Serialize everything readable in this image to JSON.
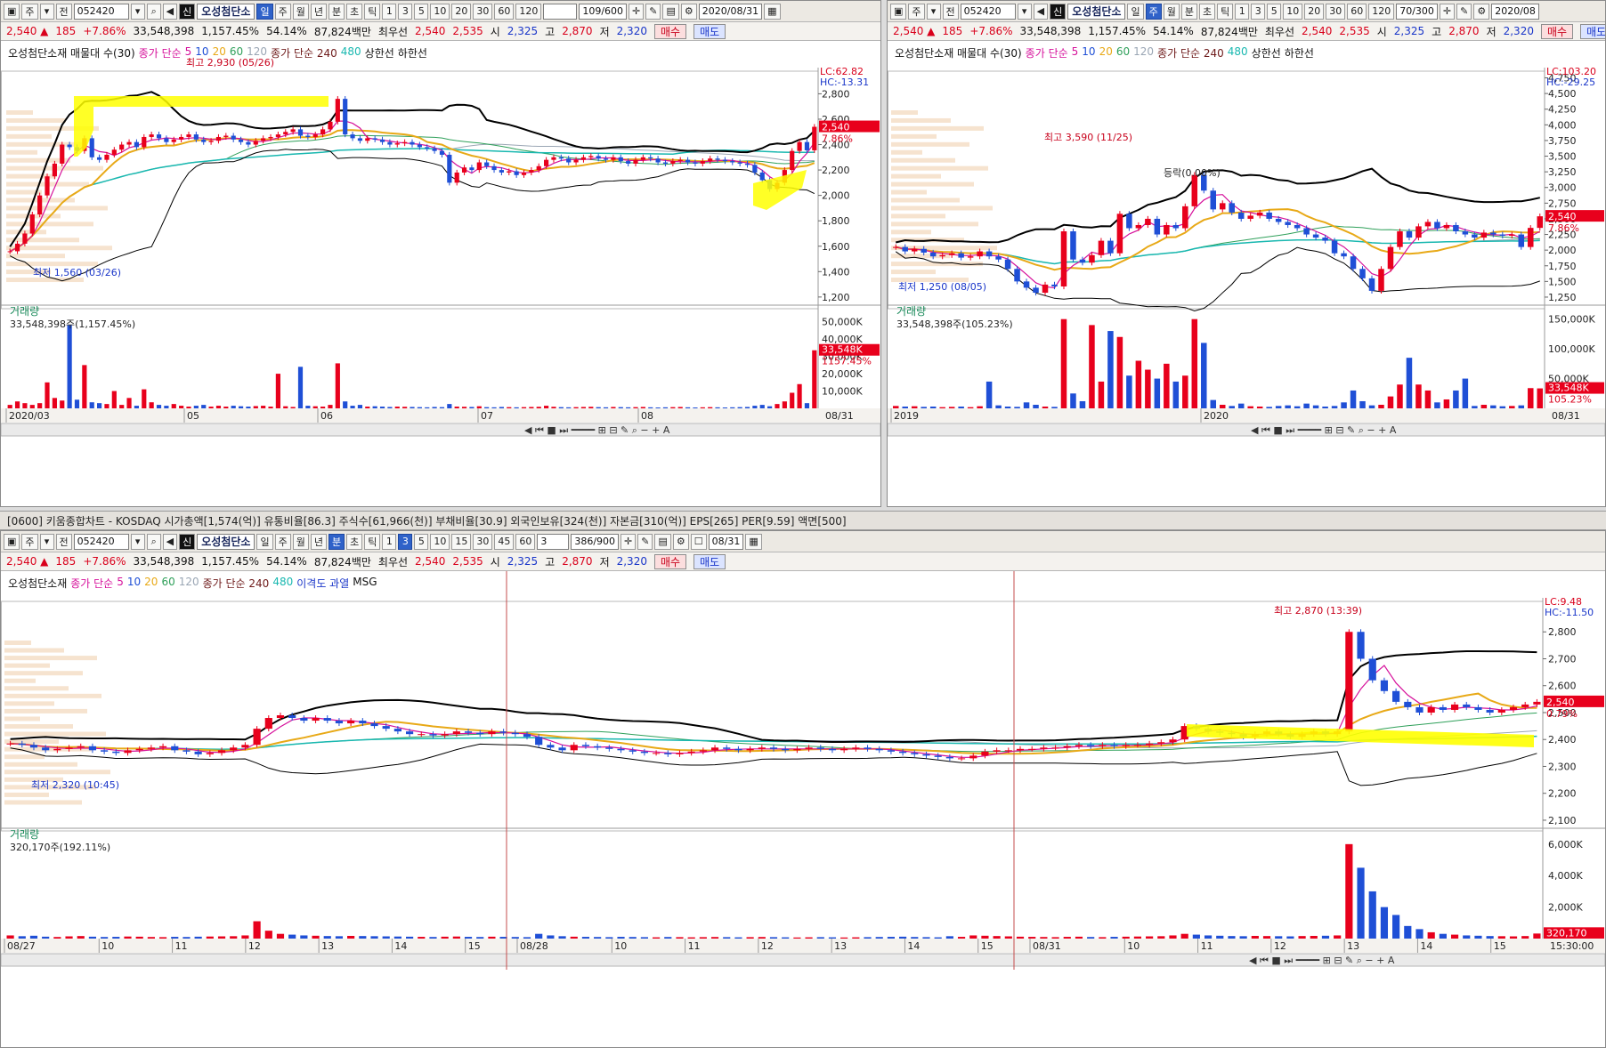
{
  "colors": {
    "up": "#e8001c",
    "down": "#1f4fd6",
    "ma5": "#d6119b",
    "ma20": "#e8a917",
    "ma60": "#2fa05a",
    "ma120": "#9aa6b4",
    "ma240": "#19b8b0",
    "ma480": "#6e1a1a",
    "boll": "#000000",
    "highlight": "#ffff00"
  },
  "panels": [
    {
      "id": "p1",
      "toolbar": {
        "type": "주",
        "prev": "전",
        "code": "052420",
        "badge": "신",
        "name": "오성첨단소",
        "periods": [
          "일",
          "주",
          "월",
          "년",
          "분",
          "초",
          "틱"
        ],
        "selected": "일",
        "nums": [
          "1",
          "3",
          "5",
          "10",
          "20",
          "30",
          "60",
          "120"
        ],
        "count": "109/600",
        "date": "2020/08/31"
      },
      "quote": {
        "price": "2,540 ▲",
        "change": "185",
        "rate": "+7.86%",
        "volume": "33,548,398",
        "vrate": "1,157.45%",
        "ratio": "54.14%",
        "amount": "87,824백만",
        "label": "최우선",
        "ask": "2,540",
        "bid": "2,535",
        "open_l": "시",
        "open": "2,325",
        "high_l": "고",
        "high": "2,870",
        "low_l": "저",
        "low": "2,320",
        "buy": "매수",
        "sell": "매도"
      },
      "legend": {
        "name": "오성첨단소재 매물대 수(30)",
        "ma_label": "종가 단순",
        "ma5": "5",
        "ma10": "10",
        "ma20": "20",
        "ma60": "60",
        "ma120": "120",
        "ma2_label": "종가 단순 240",
        "ma480": "480",
        "limit_up": "상한선",
        "limit_down": "하한선"
      },
      "lc": "LC:62.82",
      "hc": "HC:-13.31",
      "price_tag": "2,540",
      "pct_tag": "7.86%",
      "vol_label": "거래량",
      "vol_value": "33,548,398주(1,157.45%)",
      "vol_tag": "33,548K",
      "vol_pct_tag": "1157.45%",
      "date_start": "2020/03",
      "date_end": "08/31",
      "annotations": [
        {
          "text": "최고 2,930 (05/26)"
        },
        {
          "text": "최저 1,560 (03/26)"
        }
      ]
    },
    {
      "id": "p2",
      "toolbar": {
        "type": "주",
        "prev": "전",
        "code": "052420",
        "badge": "신",
        "name": "오성첨단소",
        "periods": [
          "일",
          "주",
          "월",
          "년",
          "분",
          "초",
          "틱"
        ],
        "selected": "주",
        "nums": [
          "1",
          "3",
          "5",
          "10",
          "20",
          "30",
          "60",
          "120"
        ],
        "count": "70/300",
        "date": "2020/08"
      },
      "quote": {
        "price": "2,540 ▲",
        "change": "185",
        "rate": "+7.86%",
        "volume": "33,548,398",
        "vrate": "1,157.45%",
        "ratio": "54.14%",
        "amount": "87,824백만",
        "label": "최우선",
        "ask": "2,540",
        "bid": "2,535",
        "open_l": "시",
        "open": "2,325",
        "high_l": "고",
        "high": "2,870",
        "low_l": "저",
        "low": "2,320",
        "buy": "매수",
        "sell": "매도"
      },
      "legend": {
        "name": "오성첨단소재 매물대 수(30)",
        "ma_label": "종가 단순",
        "ma5": "5",
        "ma10": "10",
        "ma20": "20",
        "ma60": "60",
        "ma120": "120",
        "ma2_label": "종가 단순 240",
        "ma480": "480",
        "limit_up": "상한선",
        "limit_down": "하한선"
      },
      "lc": "LC:103.20",
      "hc": "HC:-29.25",
      "price_tag": "2,540",
      "pct_tag": "7.86%",
      "vol_label": "거래량",
      "vol_value": "33,548,398주(105.23%)",
      "vol_tag": "33,548K",
      "vol_pct_tag": "105.23%",
      "date_start": "2019",
      "date_end": "08/31",
      "annotations": [
        {
          "text": "최고 3,590 (11/25)"
        },
        {
          "text": "최저 1,250 (08/05)"
        },
        {
          "text": "등락(0.00%)"
        }
      ]
    },
    {
      "id": "p3",
      "title": "[0600] 키움종합차트 - KOSDAQ 시가총액[1,574(억)] 유통비율[86.3] 주식수[61,966(천)] 부채비율[30.9] 외국인보유[324(천)] 자본금[310(억)] EPS[265] PER[9.59] 액면[500]",
      "toolbar": {
        "type": "주",
        "prev": "전",
        "code": "052420",
        "badge": "신",
        "name": "오성첨단소",
        "periods": [
          "일",
          "주",
          "월",
          "년",
          "분",
          "초",
          "틱"
        ],
        "selected": "분",
        "nums": [
          "1",
          "3",
          "5",
          "10",
          "15",
          "30",
          "45",
          "60"
        ],
        "sel_num": "3",
        "interval": "3",
        "count": "386/900",
        "date": "08/31"
      },
      "quote": {
        "price": "2,540 ▲",
        "change": "185",
        "rate": "+7.86%",
        "volume": "33,548,398",
        "vrate": "1,157.45%",
        "ratio": "54.14%",
        "amount": "87,824백만",
        "label": "최우선",
        "ask": "2,540",
        "bid": "2,535",
        "open_l": "시",
        "open": "2,325",
        "high_l": "고",
        "high": "2,870",
        "low_l": "저",
        "low": "2,320",
        "buy": "매수",
        "sell": "매도"
      },
      "legend": {
        "name": "오성첨단소재",
        "ma_label": "종가 단순",
        "ma5": "5",
        "ma10": "10",
        "ma20": "20",
        "ma60": "60",
        "ma120": "120",
        "ma2_label": "종가 단순 240",
        "ma480": "480",
        "extra1": "이격도 과열",
        "extra2": "MSG"
      },
      "lc": "LC:9.48",
      "hc": "HC:-11.50",
      "price_tag": "2,540",
      "pct_tag": "0.79%",
      "vol_label": "거래량",
      "vol_value": "320,170주(192.11%)",
      "vol_tag": "320,170",
      "vol_pct_tag": "192.11%",
      "date_end": "15:30:00",
      "annotations": [
        {
          "text": "최고 2,870 (13:39)"
        },
        {
          "text": "최저 2,320 (10:45)"
        }
      ]
    }
  ],
  "chart_data": [
    {
      "type": "candlestick",
      "panel": "p1",
      "x_labels": [
        "2020/03",
        "05",
        "06",
        "07",
        "08"
      ],
      "y_ticks": [
        "2,800",
        "2,600",
        "2,400",
        "2,200",
        "2,000",
        "1,800",
        "1,600",
        "1,400",
        "1,200"
      ],
      "ylim": [
        1150,
        2950
      ],
      "volume_ticks": [
        "50,000K",
        "40,000K",
        "30,000K",
        "20,000K",
        "10,000K"
      ],
      "volume_ylim": [
        0,
        55000
      ],
      "close": [
        1560,
        1620,
        1700,
        1850,
        2000,
        2150,
        2250,
        2400,
        2380,
        2350,
        2450,
        2300,
        2280,
        2320,
        2360,
        2400,
        2420,
        2380,
        2460,
        2480,
        2450,
        2420,
        2440,
        2460,
        2480,
        2440,
        2420,
        2430,
        2460,
        2470,
        2440,
        2420,
        2400,
        2430,
        2450,
        2460,
        2480,
        2500,
        2520,
        2470,
        2460,
        2480,
        2520,
        2580,
        2760,
        2480,
        2450,
        2430,
        2450,
        2440,
        2420,
        2400,
        2410,
        2420,
        2400,
        2380,
        2370,
        2350,
        2320,
        2100,
        2180,
        2220,
        2200,
        2260,
        2230,
        2200,
        2180,
        2190,
        2160,
        2180,
        2200,
        2230,
        2280,
        2300,
        2290,
        2260,
        2280,
        2300,
        2310,
        2290,
        2280,
        2300,
        2270,
        2250,
        2280,
        2300,
        2290,
        2260,
        2250,
        2270,
        2280,
        2260,
        2250,
        2270,
        2290,
        2280,
        2270,
        2260,
        2250,
        2240,
        2180,
        2120,
        2050,
        2100,
        2200,
        2350,
        2420,
        2355,
        2540
      ],
      "volume": [
        2000,
        4000,
        3000,
        2000,
        3000,
        15000,
        6000,
        4500,
        48000,
        5000,
        25000,
        3500,
        3000,
        2500,
        10000,
        2000,
        6000,
        1500,
        11000,
        3500,
        2000,
        1500,
        2500,
        1500,
        1000,
        1500,
        2000,
        1000,
        1500,
        1000,
        1500,
        1200,
        1000,
        1300,
        1500,
        1000,
        20000,
        1200,
        800,
        24000,
        1500,
        1200,
        1000,
        2000,
        26000,
        4000,
        1500,
        2000,
        1000,
        1200,
        1000,
        800,
        1000,
        900,
        800,
        700,
        600,
        800,
        700,
        2500,
        1000,
        900,
        800,
        1200,
        700,
        600,
        800,
        700,
        600,
        700,
        800,
        900,
        1500,
        900,
        700,
        600,
        700,
        800,
        900,
        700,
        600,
        800,
        700,
        600,
        700,
        800,
        600,
        500,
        600,
        700,
        800,
        600,
        500,
        600,
        700,
        600,
        500,
        600,
        700,
        800,
        1500,
        2000,
        1200,
        2500,
        4000,
        9000,
        14000,
        3000,
        33548
      ]
    },
    {
      "type": "candlestick",
      "panel": "p2",
      "x_labels": [
        "2019",
        "2020"
      ],
      "y_ticks": [
        "4,750",
        "4,500",
        "4,250",
        "4,000",
        "3,750",
        "3,500",
        "3,250",
        "3,000",
        "2,750",
        "2,500",
        "2,250",
        "2,000",
        "1,750",
        "1,500",
        "1,250"
      ],
      "ylim": [
        1150,
        4800
      ],
      "volume_ticks": [
        "150,000K",
        "100,000K",
        "50,000K"
      ],
      "volume_ylim": [
        0,
        160000
      ],
      "close": [
        2050,
        1980,
        2020,
        1960,
        1900,
        1920,
        1950,
        1880,
        1900,
        1980,
        1900,
        1850,
        1700,
        1500,
        1400,
        1320,
        1450,
        1420,
        2300,
        1850,
        1800,
        1920,
        2150,
        1950,
        2580,
        2350,
        2400,
        2500,
        2250,
        2400,
        2350,
        2700,
        3200,
        2950,
        2650,
        2750,
        2600,
        2500,
        2550,
        2600,
        2500,
        2450,
        2400,
        2350,
        2250,
        2200,
        2150,
        1950,
        1900,
        1700,
        1550,
        1350,
        1700,
        2050,
        2300,
        2200,
        2380,
        2450,
        2350,
        2400,
        2300,
        2250,
        2200,
        2280,
        2250,
        2230,
        2250,
        2050,
        2355,
        2540
      ],
      "volume": [
        4000,
        3000,
        3500,
        2500,
        3000,
        2000,
        2500,
        3000,
        2000,
        3500,
        45000,
        5000,
        3000,
        2500,
        10000,
        6000,
        3000,
        2500,
        150000,
        25000,
        12000,
        140000,
        45000,
        130000,
        120000,
        55000,
        80000,
        65000,
        50000,
        75000,
        45000,
        55000,
        150000,
        110000,
        14000,
        6000,
        4000,
        8000,
        3500,
        3000,
        2500,
        4000,
        5000,
        3500,
        8000,
        5000,
        3000,
        4000,
        10000,
        30000,
        12000,
        5000,
        6000,
        20000,
        40000,
        85000,
        40000,
        30000,
        10000,
        15000,
        30000,
        50000,
        4000,
        6000,
        5000,
        3500,
        4000,
        5000,
        34000,
        33548
      ]
    },
    {
      "type": "candlestick",
      "panel": "p3",
      "x_labels": [
        "08/27",
        "10",
        "11",
        "12",
        "13",
        "14",
        "15",
        "08/28",
        "10",
        "11",
        "12",
        "13",
        "14",
        "15",
        "08/31",
        "10",
        "11",
        "12",
        "13",
        "14",
        "15"
      ],
      "y_ticks": [
        "2,800",
        "2,700",
        "2,600",
        "2,500",
        "2,400",
        "2,300",
        "2,200",
        "2,100"
      ],
      "ylim": [
        2080,
        2900
      ],
      "volume_ticks": [
        "6,000K",
        "4,000K",
        "2,000K"
      ],
      "volume_ylim": [
        0,
        6500
      ],
      "close": [
        2385,
        2380,
        2370,
        2360,
        2365,
        2370,
        2375,
        2360,
        2355,
        2350,
        2360,
        2365,
        2370,
        2375,
        2360,
        2355,
        2345,
        2350,
        2360,
        2370,
        2380,
        2440,
        2480,
        2490,
        2480,
        2470,
        2480,
        2470,
        2460,
        2470,
        2460,
        2450,
        2440,
        2430,
        2420,
        2420,
        2415,
        2420,
        2430,
        2425,
        2420,
        2430,
        2425,
        2420,
        2410,
        2380,
        2370,
        2360,
        2380,
        2375,
        2370,
        2365,
        2360,
        2355,
        2350,
        2350,
        2345,
        2350,
        2355,
        2360,
        2370,
        2365,
        2360,
        2365,
        2370,
        2365,
        2360,
        2365,
        2370,
        2365,
        2360,
        2365,
        2370,
        2365,
        2360,
        2355,
        2350,
        2345,
        2340,
        2335,
        2330,
        2330,
        2340,
        2355,
        2360,
        2360,
        2365,
        2365,
        2370,
        2370,
        2375,
        2380,
        2375,
        2380,
        2375,
        2380,
        2380,
        2385,
        2390,
        2400,
        2450,
        2440,
        2430,
        2425,
        2420,
        2410,
        2420,
        2430,
        2420,
        2410,
        2420,
        2430,
        2420,
        2430,
        2800,
        2700,
        2620,
        2580,
        2540,
        2520,
        2500,
        2520,
        2510,
        2530,
        2520,
        2510,
        2500,
        2510,
        2520,
        2530,
        2540
      ],
      "volume": [
        200,
        150,
        180,
        120,
        100,
        140,
        160,
        120,
        100,
        110,
        130,
        120,
        100,
        90,
        110,
        100,
        120,
        130,
        140,
        150,
        200,
        1100,
        500,
        300,
        250,
        200,
        180,
        160,
        150,
        170,
        160,
        150,
        140,
        130,
        120,
        110,
        100,
        120,
        130,
        110,
        100,
        120,
        110,
        100,
        90,
        300,
        200,
        150,
        120,
        110,
        100,
        90,
        110,
        100,
        90,
        80,
        100,
        90,
        80,
        90,
        100,
        90,
        80,
        90,
        100,
        90,
        80,
        70,
        80,
        90,
        80,
        70,
        80,
        90,
        100,
        110,
        120,
        100,
        90,
        80,
        150,
        110,
        200,
        180,
        160,
        140,
        120,
        110,
        100,
        90,
        110,
        120,
        100,
        90,
        110,
        120,
        130,
        140,
        150,
        200,
        300,
        250,
        200,
        180,
        160,
        150,
        170,
        160,
        150,
        140,
        160,
        170,
        180,
        200,
        6000,
        4500,
        3000,
        2000,
        1500,
        800,
        600,
        400,
        300,
        250,
        200,
        180,
        160,
        150,
        140,
        160,
        320
      ]
    }
  ]
}
